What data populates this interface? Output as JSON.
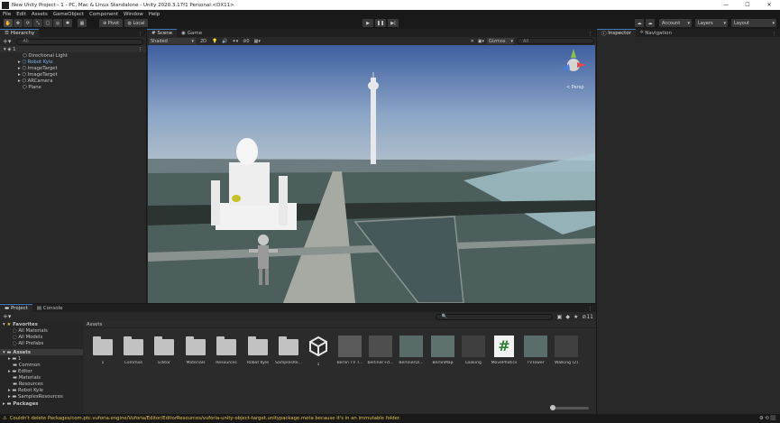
{
  "titlebar": {
    "title": "New Unity Project - 1 - PC, Mac & Linux Standalone - Unity 2020.3.17f1 Personal <DX11>",
    "minimize": "—",
    "maximize": "☐",
    "close": "✕"
  },
  "menu": [
    "File",
    "Edit",
    "Assets",
    "GameObject",
    "Component",
    "Window",
    "Help"
  ],
  "toolbar": {
    "pivot": "Pivot",
    "local": "Local",
    "account": "Account",
    "layers": "Layers",
    "layout": "Layout"
  },
  "hierarchy": {
    "tab": "Hierarchy",
    "search_placeholder": "All",
    "scene_name": "1",
    "items": [
      "Directional Light",
      "Robot Kyle",
      "ImageTarget",
      "ImageTarget",
      "ARCamera",
      "Plane"
    ]
  },
  "scene_view": {
    "tabs": [
      "Scene",
      "Game"
    ],
    "shading": "Shaded",
    "mode_2d": "2D",
    "gizmos": "Gizmos",
    "search_placeholder": "All",
    "persp": "< Persp",
    "gizmo_counter": "0"
  },
  "inspector": {
    "tabs": [
      "Inspector",
      "Navigation"
    ]
  },
  "project": {
    "tabs": [
      "Project",
      "Console"
    ],
    "favorites_label": "Favorites",
    "favorites": [
      "All Materials",
      "All Models",
      "All Prefabs"
    ],
    "assets_label": "Assets",
    "asset_folders": [
      "1",
      "Common",
      "Editor",
      "Materials",
      "Resources",
      "Robot Kyle",
      "SamplesResources"
    ],
    "packages_label": "Packages",
    "breadcrumb": "Assets",
    "hidden_count": "11",
    "grid": [
      {
        "name": "1",
        "kind": "folder"
      },
      {
        "name": "Common",
        "kind": "folder"
      },
      {
        "name": "Editor",
        "kind": "folder"
      },
      {
        "name": "Materials",
        "kind": "folder"
      },
      {
        "name": "Resources",
        "kind": "folder"
      },
      {
        "name": "Robot Kyle",
        "kind": "folder"
      },
      {
        "name": "SamplesRe...",
        "kind": "folder"
      },
      {
        "name": "1",
        "kind": "unity"
      },
      {
        "name": "Berlin TV T...",
        "kind": "model"
      },
      {
        "name": "berliner+d...",
        "kind": "model"
      },
      {
        "name": "BerlinerDi...",
        "kind": "map"
      },
      {
        "name": "BerlinMap",
        "kind": "map"
      },
      {
        "name": "Looking",
        "kind": "robot"
      },
      {
        "name": "MovePhotics",
        "kind": "script"
      },
      {
        "name": "TVTower",
        "kind": "map"
      },
      {
        "name": "Walking (2)",
        "kind": "robot"
      }
    ]
  },
  "status": {
    "message": "Couldn't delete Packages/com.ptc.vuforia.engine/Vuforia/Editor/EditorResources/vuforia-unity-object-target.unitypackage.meta because it's in an immutable folder."
  },
  "colors": {
    "accent": "#3a79bb",
    "panel": "#282828",
    "warning": "#e6c44a"
  }
}
